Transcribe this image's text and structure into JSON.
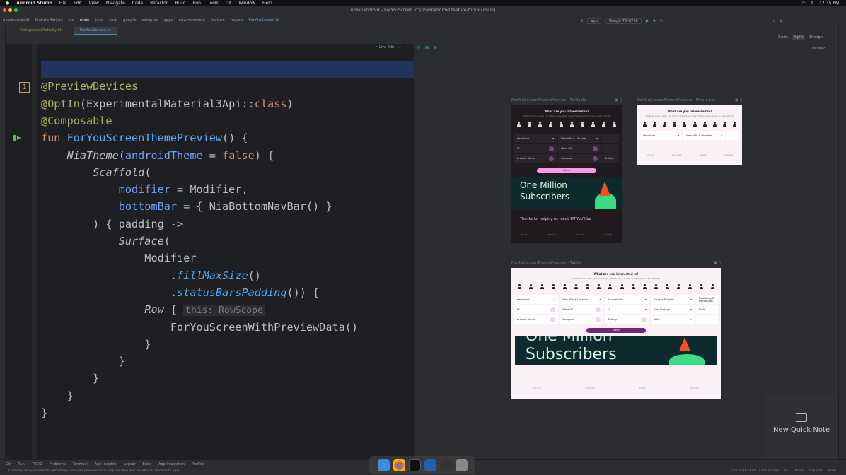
{
  "menubar": {
    "app": "Android Studio",
    "items": [
      "File",
      "Edit",
      "View",
      "Navigate",
      "Code",
      "Refactor",
      "Build",
      "Run",
      "Tools",
      "Git",
      "Window",
      "Help"
    ],
    "clock": "12:35 PM"
  },
  "window_title": "nowinandroid – ForYouScreen.kt [nowinandroid.feature-foryou.main]",
  "breadcrumb": [
    "nowinandroid",
    "feature-foryou",
    "src",
    "main",
    "java",
    "com",
    "google",
    "samples",
    "apps",
    "nowinandroid",
    "feature",
    "foryou",
    "ForYouScreen.kt"
  ],
  "toolbar": {
    "config": "app",
    "device": "Google T3-Q700"
  },
  "tabs": [
    {
      "label": "ComponentActivity.kt",
      "active": false
    },
    {
      "label": "ForYouScreen.kt",
      "active": true
    }
  ],
  "editor": {
    "live_edit": "✓ Live Edit",
    "warning_count": "1",
    "hint": "this: RowScope",
    "lines": [
      "",
      "@PreviewDevices",
      "@OptIn(ExperimentalMaterial3Api::class)",
      "@Composable",
      "fun ForYouScreenThemePreview() {",
      "    NiaTheme(androidTheme = false) {",
      "        Scaffold(",
      "            modifier = Modifier,",
      "            bottomBar = { NiaBottomNavBar() }",
      "        ) { padding ->",
      "            Surface(",
      "                Modifier",
      "                    .fillMaxSize()",
      "                    .statusBarsPadding()) {",
      "                Row {",
      "                    ForYouScreenWithPreviewData()",
      "                }",
      "            }",
      "        }",
      "    }",
      "}"
    ]
  },
  "view_modes": {
    "code": "Code",
    "split": "Split",
    "design": "Design"
  },
  "preview_status": "Paused",
  "previews": [
    {
      "title": "ForYouScreenThemePreview - Foldable"
    },
    {
      "title": "ForYouScreenThemePreview - Phone La..."
    },
    {
      "title": "ForYouScreenThemePreview - Tablet"
    }
  ],
  "preview_content": {
    "heading": "What are you interested in?",
    "subheading": "Updates from topics you follow will appear here. Follow some things to get started.",
    "topics": [
      "Headlines",
      "New APIs & Libraries",
      "Accessibility",
      "Camera & Media",
      "Publishing & Distribution",
      "UI",
      "Wear OS",
      "Data Storage",
      "Tools",
      "Android Studio",
      "Compose",
      "Testing",
      "Kotlin"
    ],
    "done": "Done",
    "banner": [
      "One Million",
      "Subscribers"
    ],
    "article": "Thanks for helping us reach 1M YouTube",
    "nav": [
      "For you",
      "Episodes",
      "Saved",
      "Interests"
    ]
  },
  "quick_note": "New Quick Note",
  "bottom_tools": [
    "Git",
    "Run",
    "TODO",
    "Problems",
    "Terminal",
    "App Insights",
    "Logcat",
    "Build",
    "App Inspection",
    "Profiler"
  ],
  "status_message": "Compose Preview refresh: refreshing Compose previews total elapsed time was 3 s 891 ms (moments ago)",
  "status_right": [
    "107:1 (16 chars, 1 line break)",
    "LF",
    "UTF-8",
    "4 spaces",
    "main"
  ],
  "colors": {
    "accent": "#4a88c7",
    "selection": "#21345e",
    "button_pink": "#f59be9",
    "button_purple": "#6b2a72"
  }
}
